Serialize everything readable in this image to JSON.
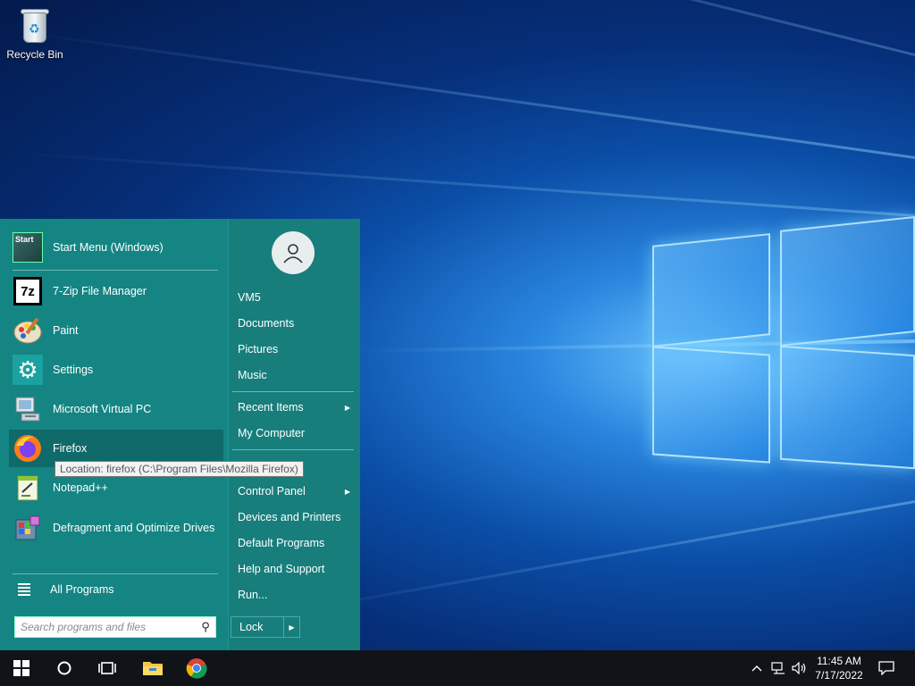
{
  "desktop": {
    "icons": [
      {
        "label": "Recycle Bin",
        "icon": "recycle-bin-icon"
      }
    ]
  },
  "start_menu": {
    "pinned": {
      "label": "Start Menu (Windows)",
      "icon": "start-menu-icon",
      "icon_text": "Start"
    },
    "apps": [
      {
        "label": "7-Zip File Manager",
        "icon": "7zip-icon",
        "icon_text": "7z"
      },
      {
        "label": "Paint",
        "icon": "paint-icon"
      },
      {
        "label": "Settings",
        "icon": "settings-gear-icon"
      },
      {
        "label": "Microsoft Virtual PC",
        "icon": "virtual-pc-icon"
      },
      {
        "label": "Firefox",
        "icon": "firefox-icon"
      },
      {
        "label": "Notepad++",
        "icon": "notepad-plus-plus-icon"
      },
      {
        "label": "Defragment and Optimize Drives",
        "icon": "defragment-icon"
      }
    ],
    "all_programs_label": "All Programs",
    "search_placeholder": "Search programs and files",
    "tooltip": "Location: firefox (C:\\Program Files\\Mozilla Firefox)",
    "right": {
      "user_items": [
        "VM5",
        "Documents",
        "Pictures",
        "Music"
      ],
      "middle_items": [
        {
          "label": "Recent Items",
          "submenu": true
        },
        {
          "label": "My Computer",
          "submenu": false
        }
      ],
      "system_items": [
        {
          "label": "Control Panel",
          "submenu": true
        },
        {
          "label": "Devices and Printers",
          "submenu": false
        },
        {
          "label": "Default Programs",
          "submenu": false
        },
        {
          "label": "Help and Support",
          "submenu": false
        },
        {
          "label": "Run...",
          "submenu": false
        }
      ],
      "lock_label": "Lock"
    }
  },
  "taskbar": {
    "buttons": [
      "windows-start-icon",
      "cortana-search-icon",
      "task-view-icon",
      "file-explorer-icon",
      "chrome-icon"
    ],
    "tray_icons": [
      "chevron-up-icon",
      "network-icon",
      "volume-icon"
    ],
    "time": "11:45 AM",
    "date": "7/17/2022",
    "notifications_icon": "action-center-icon"
  }
}
